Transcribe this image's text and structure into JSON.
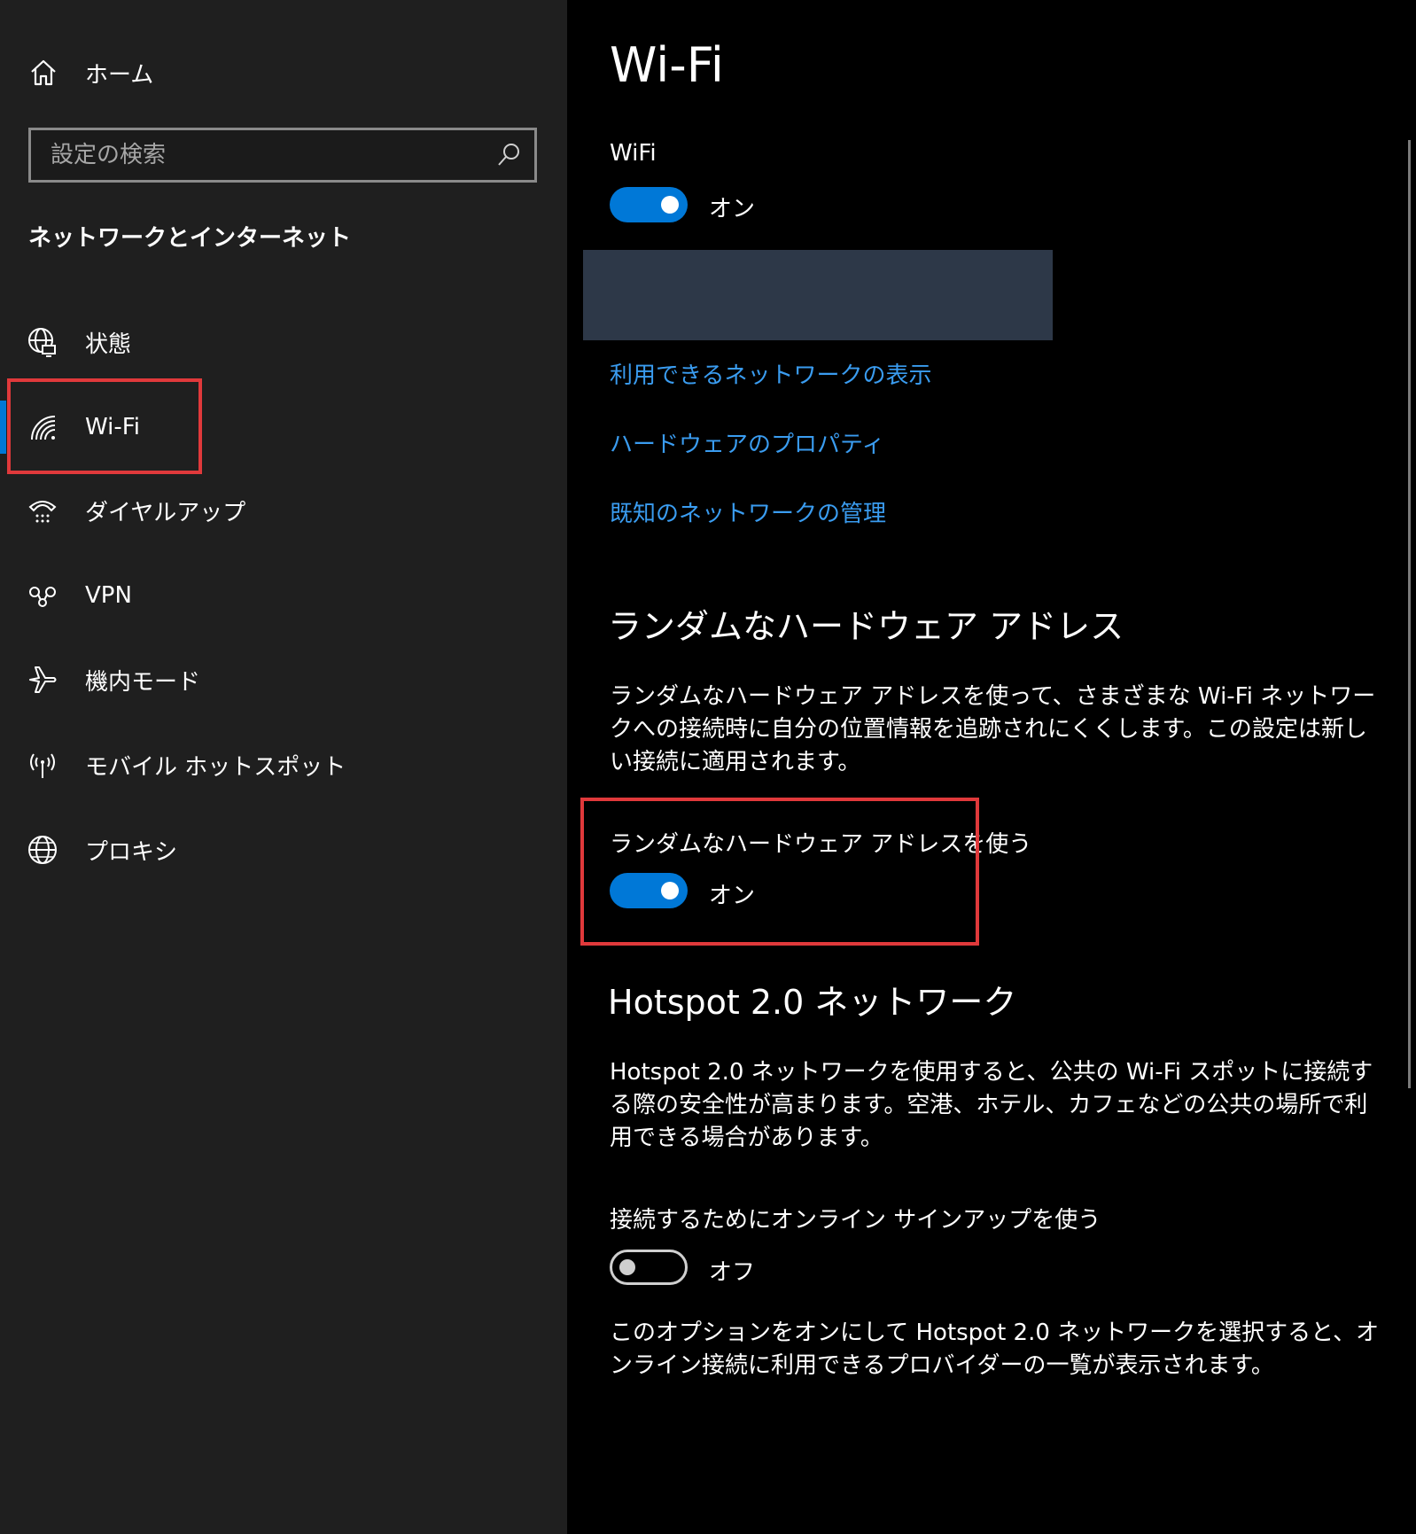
{
  "sidebar": {
    "home_label": "ホーム",
    "search_placeholder": "設定の検索",
    "section_title": "ネットワークとインターネット",
    "items": [
      {
        "label": "状態",
        "icon": "globe-status-icon"
      },
      {
        "label": "Wi-Fi",
        "icon": "wifi-icon"
      },
      {
        "label": "ダイヤルアップ",
        "icon": "dialup-icon"
      },
      {
        "label": "VPN",
        "icon": "vpn-icon"
      },
      {
        "label": "機内モード",
        "icon": "airplane-icon"
      },
      {
        "label": "モバイル ホットスポット",
        "icon": "hotspot-icon"
      },
      {
        "label": "プロキシ",
        "icon": "globe-icon"
      }
    ],
    "selected_index": 1
  },
  "main": {
    "title": "Wi-Fi",
    "wifi_label": "WiFi",
    "wifi_toggle_state": "オン",
    "links": [
      "利用できるネットワークの表示",
      "ハードウェアのプロパティ",
      "既知のネットワークの管理"
    ],
    "random_section": {
      "heading": "ランダムなハードウェア アドレス",
      "description": "ランダムなハードウェア アドレスを使って、さまざまな Wi-Fi ネットワークへの接続時に自分の位置情報を追跡されにくくします。この設定は新しい接続に適用されます。",
      "toggle_label": "ランダムなハードウェア アドレスを使う",
      "toggle_state": "オン"
    },
    "hotspot_section": {
      "heading": "Hotspot 2.0 ネットワーク",
      "description": "Hotspot 2.0 ネットワークを使用すると、公共の Wi-Fi スポットに接続する際の安全性が高まります。空港、ホテル、カフェなどの公共の場所で利用できる場合があります。",
      "toggle_label": "接続するためにオンライン サインアップを使う",
      "toggle_state": "オフ",
      "footer": "このオプションをオンにして Hotspot 2.0 ネットワークを選択すると、オンライン接続に利用できるプロバイダーの一覧が表示されます。"
    }
  },
  "colors": {
    "accent": "#0078d7",
    "link": "#3a9cf0",
    "highlight_box": "#e0393b",
    "sidebar_bg": "#1f1f1f",
    "main_bg": "#000000"
  }
}
